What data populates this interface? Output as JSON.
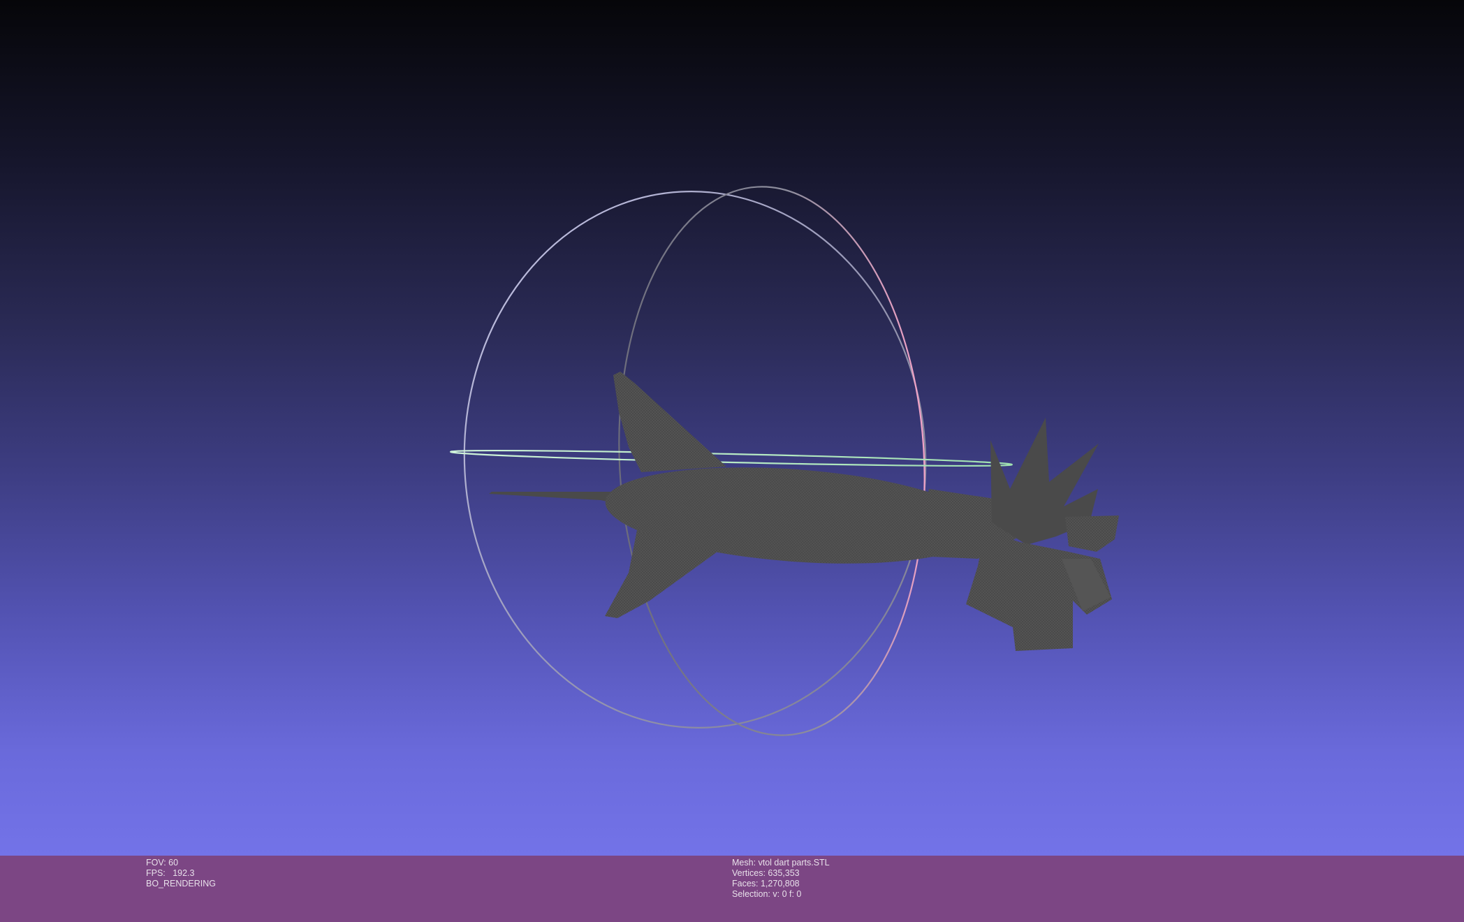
{
  "viewer": {
    "background_top": "#060609",
    "background_bottom": "#7373e8",
    "mesh_color": "#4a4a4a",
    "trackball_colors": {
      "ring_a": "#b8b8e6",
      "ring_b": "#f2a3c7",
      "ring_c": "#bdf0c8"
    }
  },
  "info_left": {
    "fov": "FOV: 60",
    "fps": "FPS:   192.3",
    "mode": "BO_RENDERING"
  },
  "info_right": {
    "mesh": "Mesh: vtol dart parts.STL",
    "vertices": "Vertices: 635,353",
    "faces": "Faces: 1,270,808",
    "selection": "Selection: v: 0 f: 0"
  },
  "info_bar_color": "#7c4684"
}
